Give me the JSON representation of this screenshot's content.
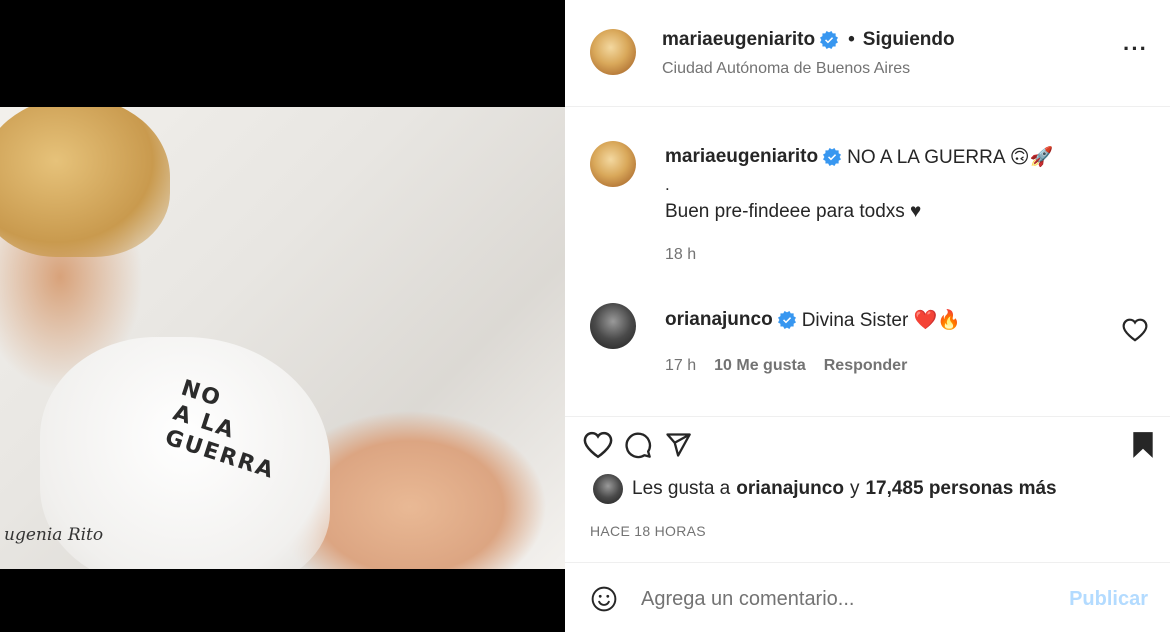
{
  "post": {
    "photo": {
      "shirt_text": "NO\nA LA\nGUERRA",
      "signature": "ugenia Rito"
    }
  },
  "header": {
    "username": "mariaeugeniarito",
    "separator": "•",
    "follow_status": "Siguiendo",
    "location": "Ciudad Autónoma de Buenos Aires",
    "more_label": "···"
  },
  "caption": {
    "username": "mariaeugeniarito",
    "text": "NO A LA GUERRA 🙃🚀",
    "dot": ".",
    "line2": "Buen pre-findeee para todxs ♥",
    "time": "18 h"
  },
  "comment": {
    "username": "orianajunco",
    "text": "Divina Sister ❤️🔥",
    "time": "17 h",
    "likes": "10 Me gusta",
    "reply": "Responder"
  },
  "likes": {
    "prefix": "Les gusta a",
    "user": "orianajunco",
    "connector": "y",
    "others": "17,485 personas más"
  },
  "timestamp": "HACE 18 HORAS",
  "comment_box": {
    "placeholder": "Agrega un comentario...",
    "publish_label": "Publicar"
  },
  "colors": {
    "verified": "#3897f0",
    "muted": "#737373",
    "publish_disabled": "#b3dbff"
  },
  "icons": [
    "verified-badge-icon",
    "more-icon",
    "heart-icon",
    "comment-icon",
    "share-icon",
    "bookmark-icon",
    "emoji-icon"
  ]
}
